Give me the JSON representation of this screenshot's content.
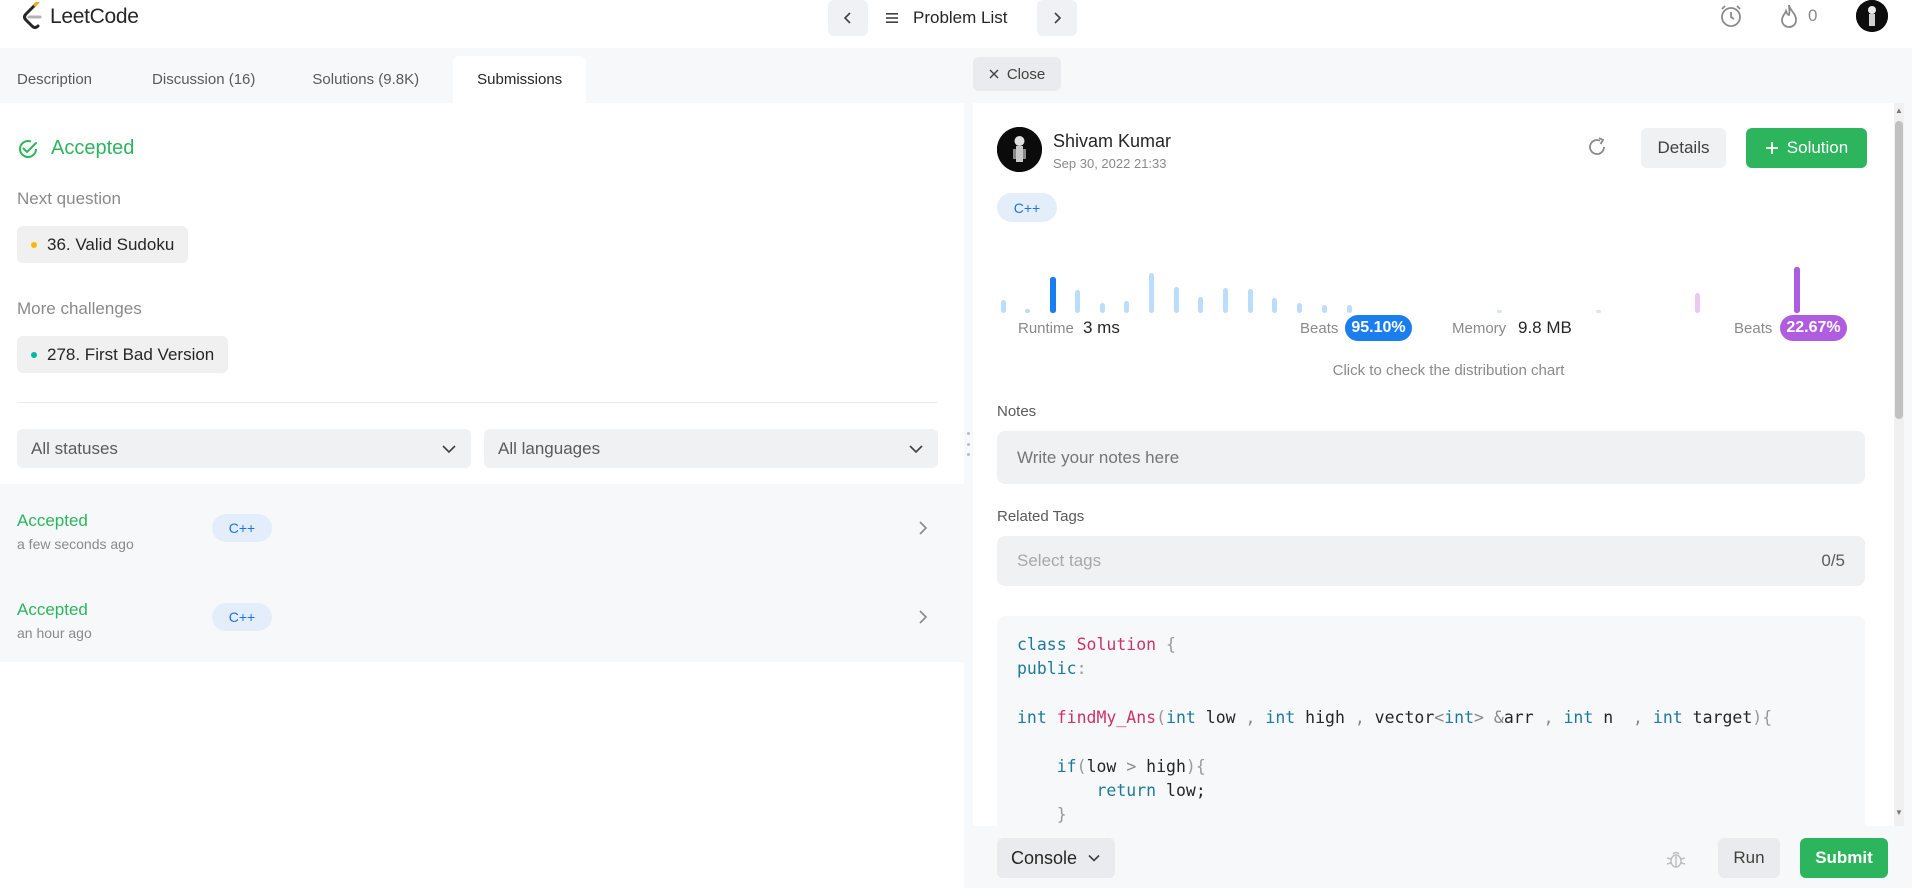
{
  "nav": {
    "logo_text": "LeetCode",
    "problem_list_label": "Problem List",
    "streak_count": "0"
  },
  "left": {
    "tabs": [
      {
        "label": "Description"
      },
      {
        "label": "Discussion (16)"
      },
      {
        "label": "Solutions (9.8K)"
      },
      {
        "label": "Submissions"
      }
    ],
    "status_title": "Accepted",
    "next_question_label": "Next question",
    "next_question": {
      "title": "36. Valid Sudoku",
      "difficulty_color": "#ffb800"
    },
    "more_challenges_label": "More challenges",
    "more_challenge": {
      "title": "278. First Bad Version",
      "difficulty_color": "#00b8a3"
    },
    "status_filter": "All statuses",
    "language_filter": "All languages",
    "submissions": [
      {
        "status": "Accepted",
        "time": "a few seconds ago",
        "lang": "C++"
      },
      {
        "status": "Accepted",
        "time": "an hour ago",
        "lang": "C++"
      }
    ]
  },
  "right": {
    "close_label": "Close",
    "user_name": "Shivam Kumar",
    "submitted_at": "Sep 30, 2022 21:33",
    "details_label": "Details",
    "solution_label": "Solution",
    "language": "C++",
    "runtime_label": "Runtime",
    "runtime_value": "3 ms",
    "runtime_beats_label": "Beats",
    "runtime_beats": "95.10%",
    "memory_label": "Memory",
    "memory_value": "9.8 MB",
    "memory_beats_label": "Beats",
    "memory_beats": "22.67%",
    "dist_hint": "Click to check the distribution chart",
    "notes_label": "Notes",
    "notes_placeholder": "Write your notes here",
    "tags_label": "Related Tags",
    "tags_placeholder": "Select tags",
    "tags_count": "0/5",
    "code_lines": [
      "class Solution {",
      "public:",
      "",
      "int findMy_Ans(int low , int high , vector<int> &arr , int n  , int target){",
      "",
      "    if(low > high){",
      "        return low;",
      "    }"
    ]
  },
  "bottom": {
    "console_label": "Console",
    "run_label": "Run",
    "submit_label": "Submit"
  },
  "colors": {
    "accent_green": "#2db55d",
    "runtime_blue": "#1a7df0",
    "memory_purple": "#b05ce0"
  }
}
